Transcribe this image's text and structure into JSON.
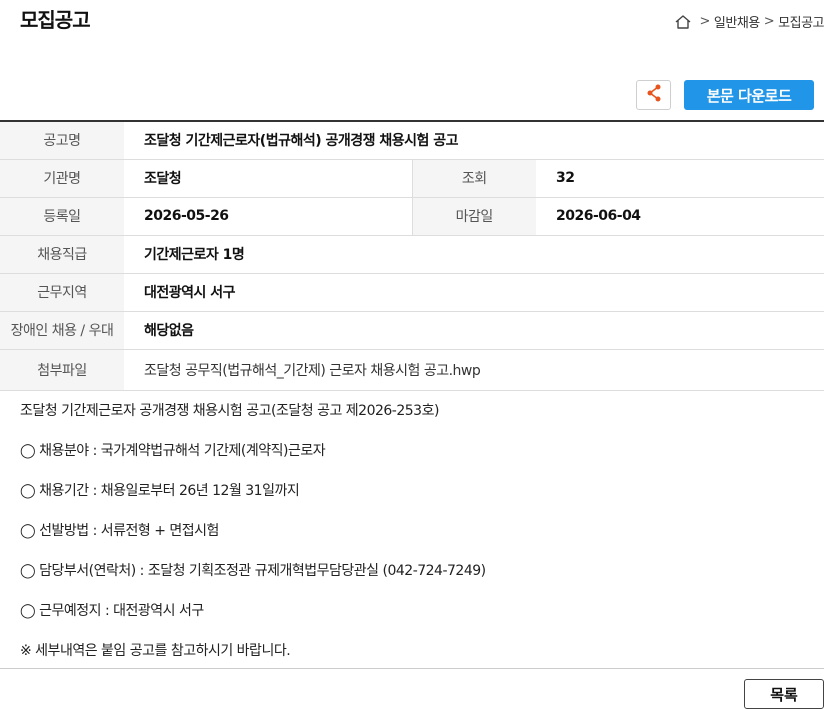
{
  "header": {
    "title": "모집공고",
    "breadcrumb": [
      "일반채용",
      "모집공고"
    ],
    "breadcrumb_sep": ">"
  },
  "actions": {
    "download_label": "본문 다운로드",
    "share_icon": "share-icon"
  },
  "info": {
    "announcement_label": "공고명",
    "announcement_value": "조달청 기간제근로자(법규해석) 공개경쟁 채용시험 공고",
    "agency_label": "기관명",
    "agency_value": "조달청",
    "views_label": "조회",
    "views_value": "32",
    "registered_label": "등록일",
    "registered_value": "2026-05-26",
    "deadline_label": "마감일",
    "deadline_value": "2026-06-04",
    "position_label": "채용직급",
    "position_value": "기간제근로자 1명",
    "location_label": "근무지역",
    "location_value": "대전광역시 서구",
    "disability_label": "장애인 채용 / 우대",
    "disability_value": "해당없음",
    "attachment_label": "첨부파일",
    "attachment_value": "조달청 공무직(법규해석_기간제) 근로자 채용시험 공고.hwp"
  },
  "content": {
    "lines": [
      "조달청 기간제근로자 공개경쟁 채용시험 공고(조달청 공고 제2026-253호)",
      "◯ 채용분야 : 국가계약법규해석 기간제(계약직)근로자",
      "◯ 채용기간 : 채용일로부터  26년 12월 31일까지",
      "◯ 선발방법 : 서류전형 + 면접시험",
      "◯ 담당부서(연락처) : 조달청 기획조정관 규제개혁법무담당관실  (042-724-7249)",
      "◯ 근무예정지 : 대전광역시 서구",
      "※ 세부내역은 붙임 공고를 참고하시기 바랍니다."
    ]
  },
  "footer": {
    "list_label": "목록"
  },
  "colors": {
    "accent": "#2196e8",
    "share": "#e8541e"
  }
}
